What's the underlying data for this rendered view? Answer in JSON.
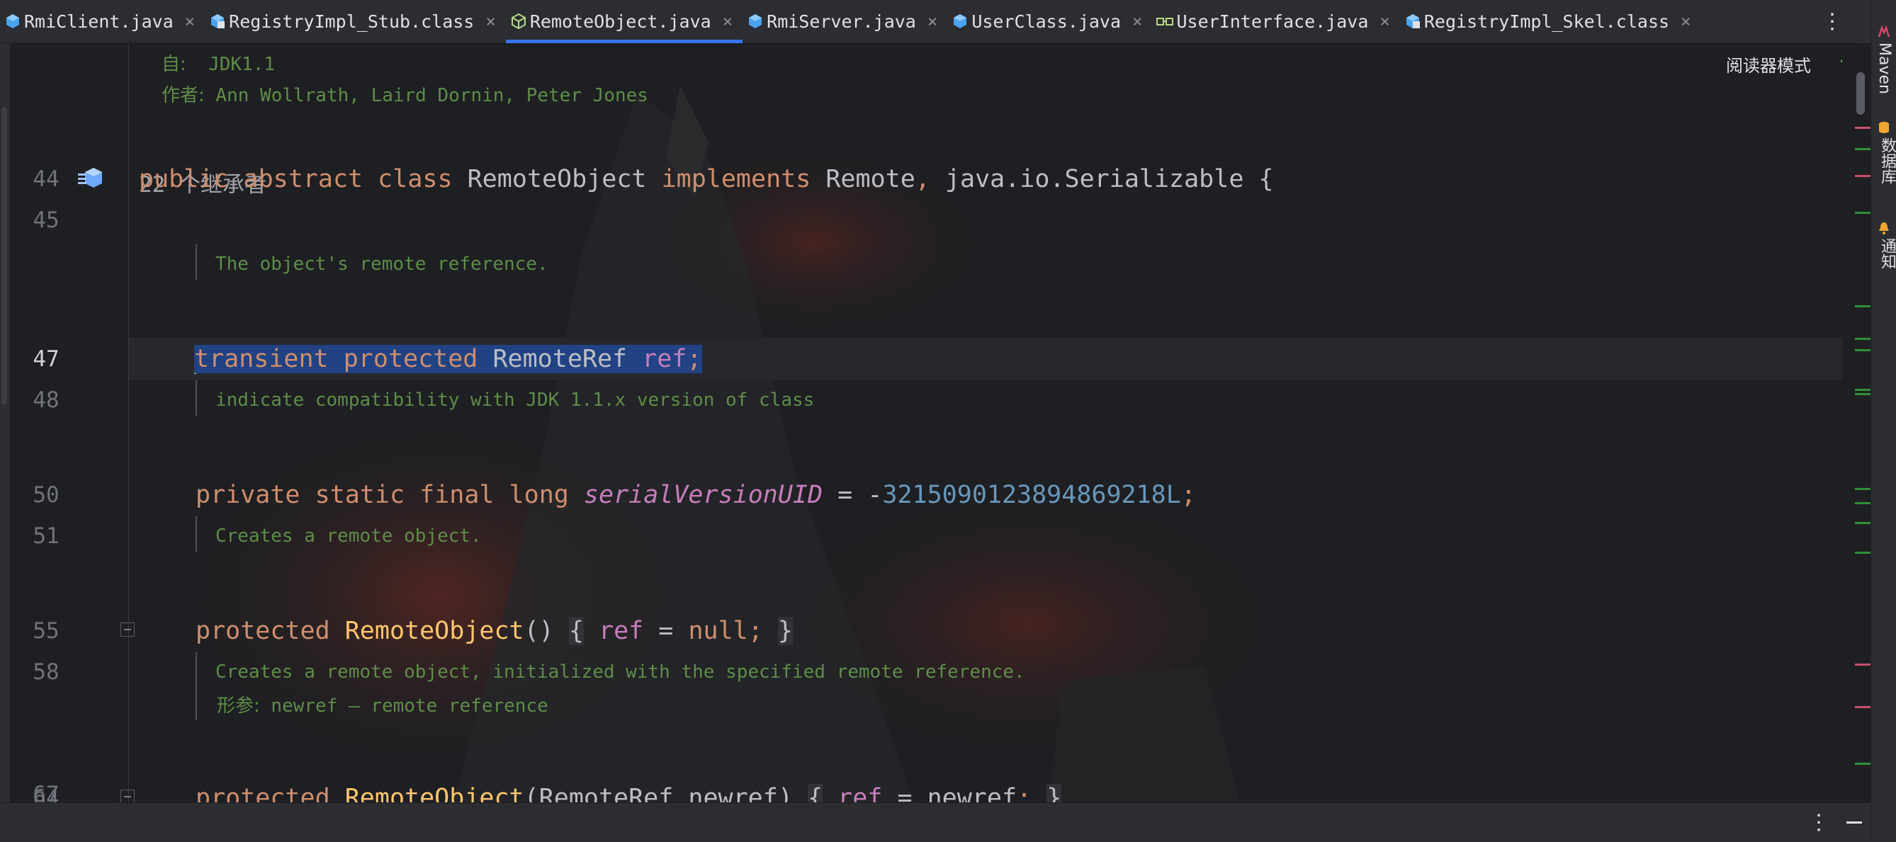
{
  "tabs": [
    {
      "label": "RmiClient.java",
      "icon": "java-class-icon",
      "active": false
    },
    {
      "label": "RegistryImpl_Stub.class",
      "icon": "compiled-class-icon",
      "active": false
    },
    {
      "label": "RemoteObject.java",
      "icon": "abstract-class-icon",
      "active": true
    },
    {
      "label": "RmiServer.java",
      "icon": "java-class-icon",
      "active": false
    },
    {
      "label": "UserClass.java",
      "icon": "java-class-icon",
      "active": false
    },
    {
      "label": "UserInterface.java",
      "icon": "interface-icon",
      "active": false
    },
    {
      "label": "RegistryImpl_Skel.class",
      "icon": "compiled-class-icon",
      "active": false
    }
  ],
  "close_glyph": "×",
  "reader_mode": "阅读器模式",
  "doc_header": {
    "since_label": "自:",
    "since_value": "JDK1.1",
    "author_label": "作者:",
    "author_value": "Ann Wollrath, Laird Dornin, Peter Jones"
  },
  "inheritors": "22 个继承者",
  "lines": {
    "l44": "44",
    "l45": "45",
    "l47": "47",
    "l48": "48",
    "l50": "50",
    "l51": "51",
    "l55": "55",
    "l58": "58",
    "l64": "64",
    "l67": "67"
  },
  "code": {
    "class_decl": {
      "k_public": "public",
      "k_abstract": "abstract",
      "k_class": "class",
      "name": "RemoteObject",
      "k_implements": "implements",
      "t_remote": "Remote",
      "comma": ",",
      "t_serial": "java.io.Serializable",
      "brace": "{"
    },
    "doc_ref": "The object's remote reference.",
    "field_ref": {
      "k_transient": "transient",
      "k_protected": "protected",
      "type": "RemoteRef",
      "name": "ref",
      "semi": ";"
    },
    "doc_compat": "indicate compatibility with JDK 1.1.x version of class",
    "field_uid": {
      "k_private": "private",
      "k_static": "static",
      "k_final": "final",
      "k_long": "long",
      "name": "serialVersionUID",
      "eq": "=",
      "minus": "-",
      "value": "3215090123894869218L",
      "semi": ";"
    },
    "doc_ctor1": "Creates a remote object.",
    "ctor1": {
      "k_protected": "protected",
      "name": "RemoteObject",
      "parens": "()",
      "open": "{",
      "field": "ref",
      "eq": "=",
      "k_null": "null",
      "semi": ";",
      "close": "}"
    },
    "doc_ctor2": "Creates a remote object, initialized with the specified remote reference.",
    "doc_ctor2_param_label": "形参:",
    "doc_ctor2_param": "newref – remote reference",
    "ctor2": {
      "k_protected": "protected",
      "name": "RemoteObject",
      "params": "(RemoteRef newref)",
      "open": "{",
      "field": "ref",
      "eq": "=",
      "arg": "newref",
      "semi": ";",
      "close": "}"
    }
  },
  "toolstrip": {
    "maven": "Maven",
    "database": "数据库",
    "notifications": "通知"
  },
  "colors": {
    "accent": "#3574f0",
    "keyword": "#cf8e6d",
    "field": "#c77dbb",
    "method": "#ffc66d",
    "number": "#6897bb",
    "doc": "#5f8c4a",
    "selection": "#214283"
  }
}
